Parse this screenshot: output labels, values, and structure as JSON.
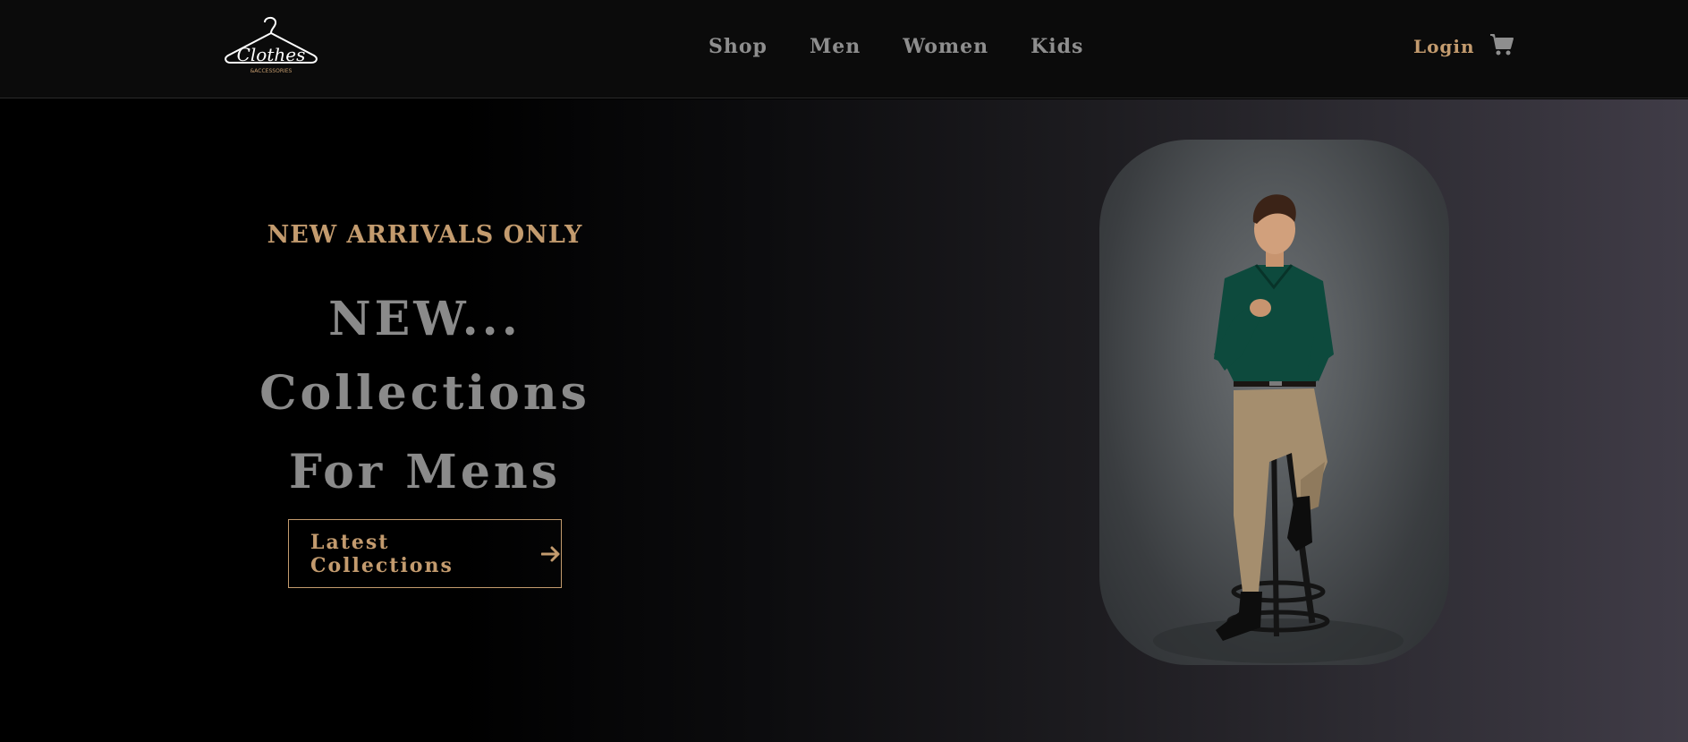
{
  "brand": {
    "logo_text": "Clothes",
    "logo_subtext": "&ACCESSORIES"
  },
  "nav": {
    "items": [
      {
        "label": "Shop"
      },
      {
        "label": "Men"
      },
      {
        "label": "Women"
      },
      {
        "label": "Kids"
      }
    ],
    "login_label": "Login",
    "cart_icon": "shopping-cart-icon"
  },
  "hero": {
    "eyebrow": "NEW ARRIVALS ONLY",
    "line1": "NEW...",
    "line2": "Collections",
    "line3": "For Mens",
    "cta_label": "Latest Collections",
    "cta_icon": "arrow-right-icon",
    "image_alt": "man in green shirt sitting on a stool"
  },
  "colors": {
    "accent": "#c39b6e",
    "nav_text": "#8e8e8e",
    "headline_text": "#8a8a8a",
    "navbar_bg": "#0b0b0b"
  }
}
